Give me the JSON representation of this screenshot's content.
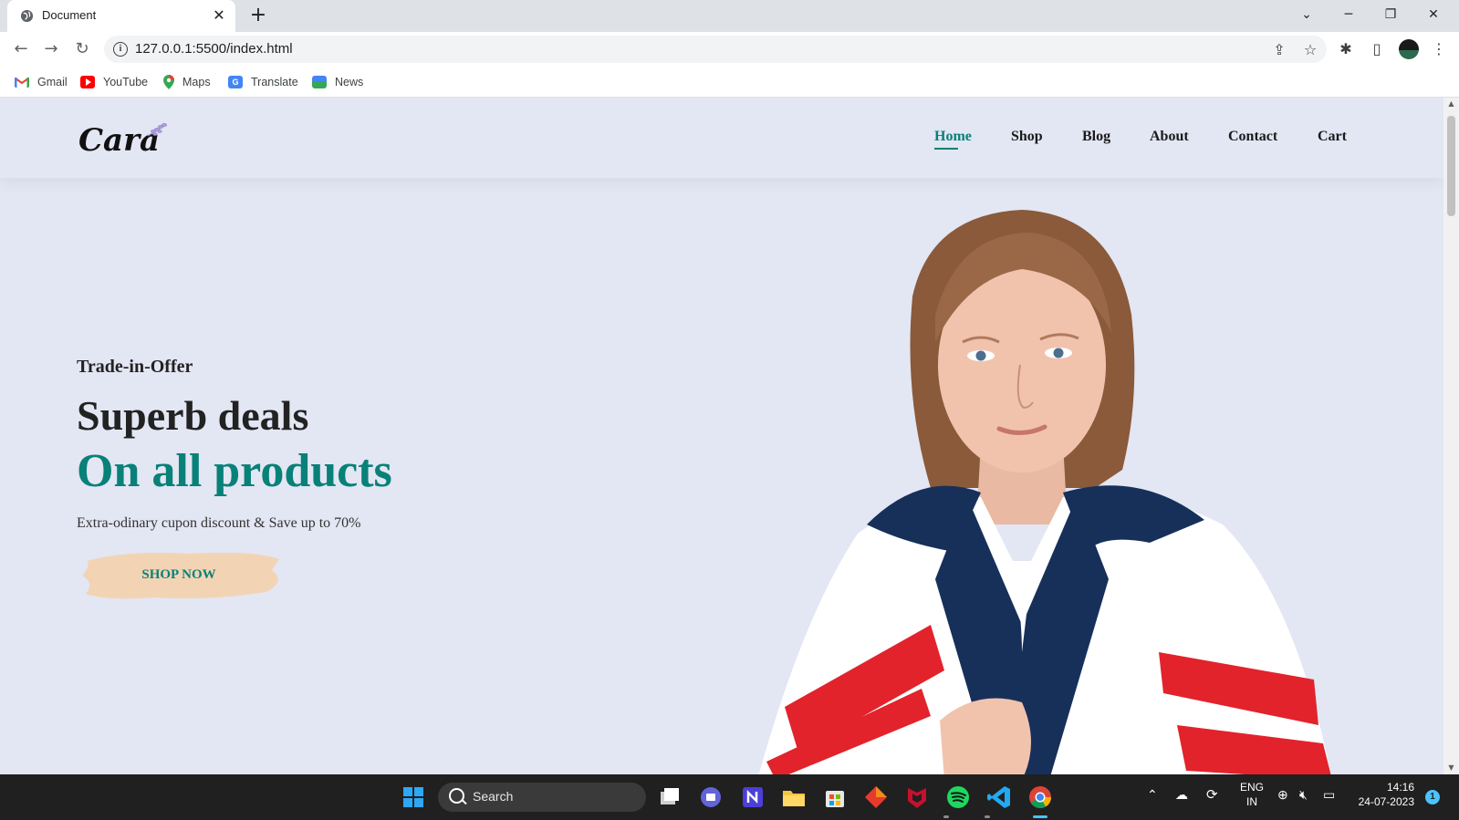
{
  "browser": {
    "tab_title": "Document",
    "tab_close": "✕",
    "new_tab": "+",
    "url": "127.0.0.1:5500/index.html",
    "bookmarks": [
      {
        "label": "Gmail",
        "icon": "gmail-icon"
      },
      {
        "label": "YouTube",
        "icon": "youtube-icon"
      },
      {
        "label": "Maps",
        "icon": "maps-icon"
      },
      {
        "label": "Translate",
        "icon": "translate-icon"
      },
      {
        "label": "News",
        "icon": "news-icon"
      }
    ]
  },
  "site": {
    "logo_text": "Cara",
    "nav": [
      "Home",
      "Shop",
      "Blog",
      "About",
      "Contact",
      "Cart"
    ],
    "active_nav": "Home",
    "hero": {
      "eyebrow": "Trade-in-Offer",
      "headline": "Superb deals",
      "highlight": "On all products",
      "subtext": "Extra-odinary cupon discount & Save up to 70%",
      "cta": "SHOP NOW"
    },
    "colors": {
      "background": "#e3e6f3",
      "accent": "#088178",
      "cta_brush": "#f2d4b4"
    }
  },
  "taskbar": {
    "search_label": "Search",
    "language": "ENG",
    "region": "IN",
    "time": "14:16",
    "date": "24-07-2023",
    "notification_count": "1"
  }
}
